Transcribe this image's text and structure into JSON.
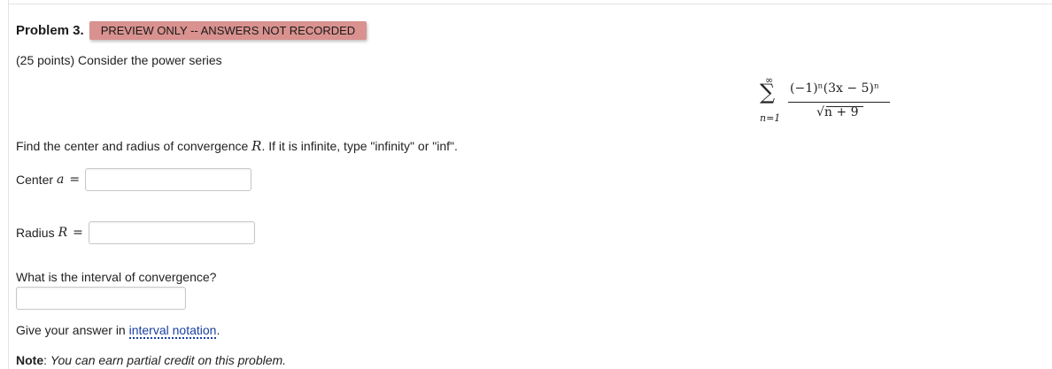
{
  "problem": {
    "title": "Problem 3.",
    "badge": "PREVIEW ONLY -- ANSWERS NOT RECORDED",
    "intro": "(25 points) Consider the power series"
  },
  "formula": {
    "sum_upper": "∞",
    "sum_symbol": "∑",
    "sum_lower": "n=1",
    "numerator": "(−1)ⁿ(3x − 5)ⁿ",
    "denominator": "√n + 9"
  },
  "find": {
    "text_before": "Find the center and radius of convergence ",
    "variable": "R",
    "text_after": ". If it is infinite, type \"infinity\" or \"inf\"."
  },
  "center": {
    "label": "Center",
    "variable": "a",
    "equals": "=",
    "value": ""
  },
  "radius": {
    "label": "Radius",
    "variable": "R",
    "equals": "=",
    "value": ""
  },
  "interval": {
    "question": "What is the interval of convergence?",
    "value": "",
    "give_prefix": "Give your answer in ",
    "link_text": "interval notation",
    "give_suffix": "."
  },
  "note": {
    "label": "Note",
    "separator": ": ",
    "text": "You can earn partial credit on this problem."
  },
  "colors": {
    "badge_bg": "#d9928f",
    "link": "#1a3fa0"
  }
}
